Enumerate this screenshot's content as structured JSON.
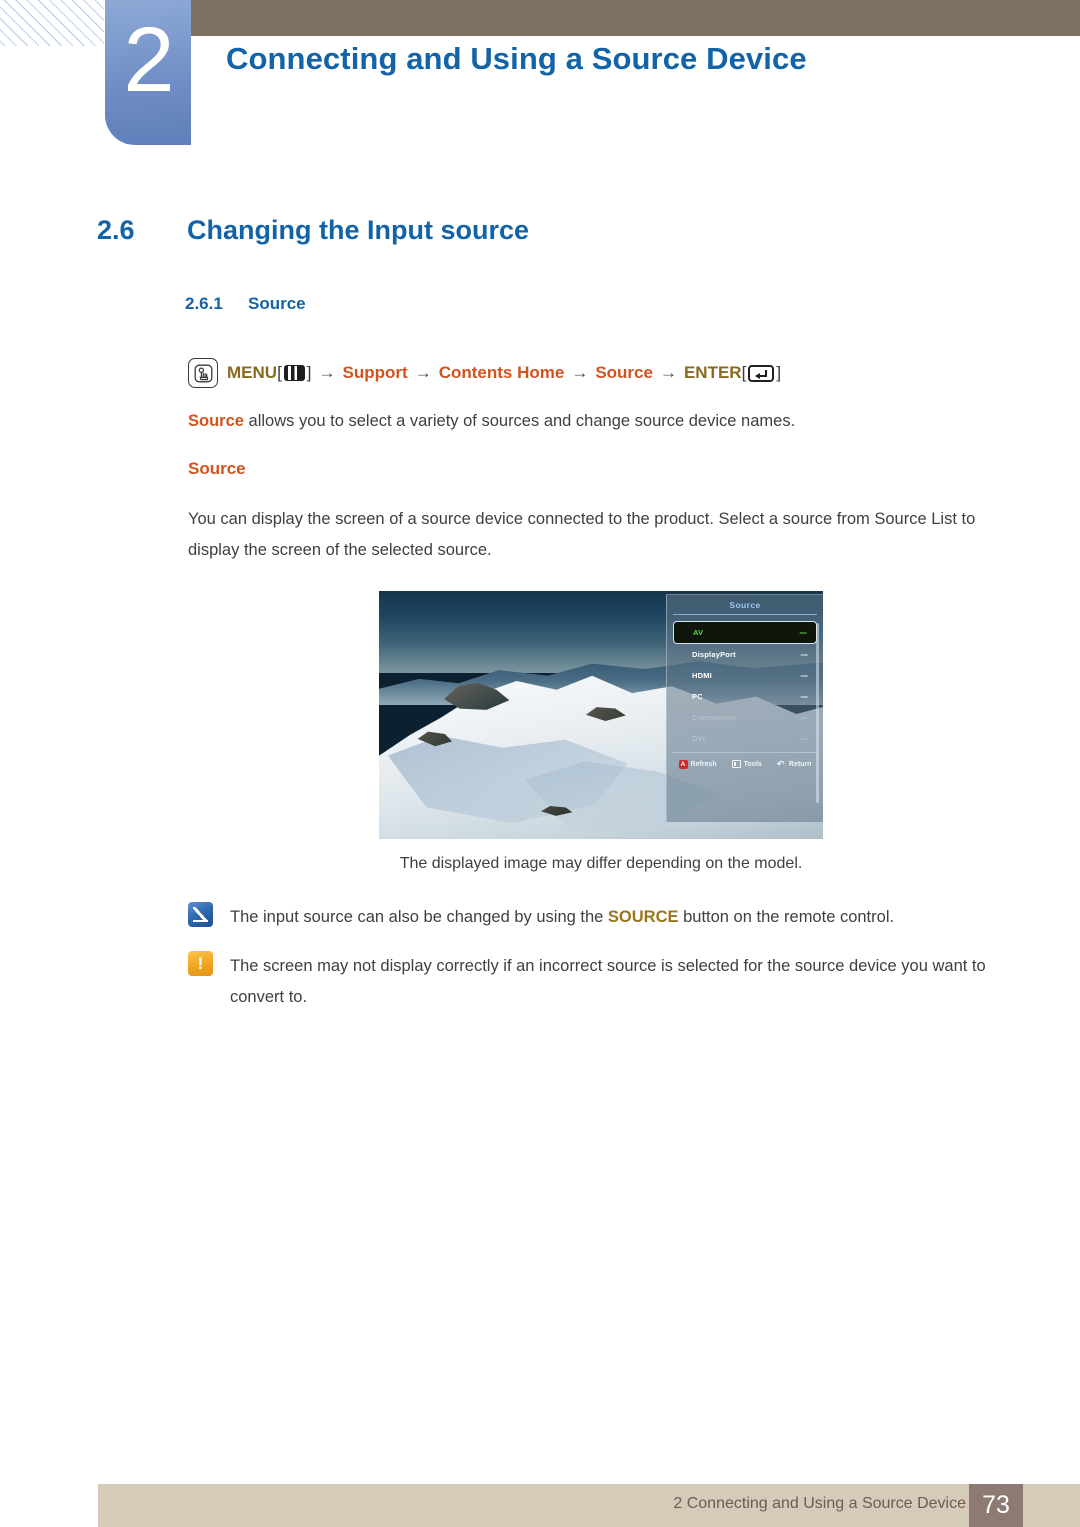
{
  "header": {
    "chapter_number": "2",
    "chapter_title": "Connecting and Using a Source Device",
    "brown_color": "#7e7062",
    "blue_color": "#1263a8"
  },
  "section": {
    "number": "2.6",
    "title": "Changing the Input source",
    "sub_number": "2.6.1",
    "sub_title": "Source"
  },
  "menu_path": {
    "hand_icon": "hand-press-icon",
    "menu_label": "MENU",
    "menu_icon": "menu-grid-icon",
    "arrow": "→",
    "bracket_open": "[",
    "bracket_close": "]",
    "step_support": "Support",
    "step_contents_home": "Contents Home",
    "step_source": "Source",
    "enter_label": "ENTER",
    "enter_icon": "enter-return-icon"
  },
  "body": {
    "lead_keyword": "Source",
    "lead_rest": " allows you to select a variety of sources and change source device names.",
    "sub_heading": "Source",
    "description": "You can display the screen of a source device connected to the product. Select a source from Source List to display the screen of the selected source."
  },
  "figure": {
    "caption": "The displayed image may differ depending on the model.",
    "osd": {
      "title": "Source",
      "items": [
        {
          "label": "AV",
          "value": "----",
          "state": "selected"
        },
        {
          "label": "DisplayPort",
          "value": "----",
          "state": "normal"
        },
        {
          "label": "HDMI",
          "value": "----",
          "state": "normal"
        },
        {
          "label": "PC",
          "value": "----",
          "state": "normal"
        },
        {
          "label": "Component",
          "value": "----",
          "state": "dimmed"
        },
        {
          "label": "DVI",
          "value": "----",
          "state": "dimmed"
        }
      ],
      "footer": [
        {
          "icon": "a-button-icon",
          "icon_label": "A",
          "label": "Refresh"
        },
        {
          "icon": "tools-icon",
          "icon_label": "",
          "label": "Tools"
        },
        {
          "icon": "return-icon",
          "icon_label": "↶",
          "label": "Return"
        }
      ]
    }
  },
  "notes": [
    {
      "icon": "note-pen-icon",
      "text_before": "The input source can also be changed by using the ",
      "highlight": "SOURCE",
      "text_after": " button on the remote control."
    },
    {
      "icon": "caution-exclamation-icon",
      "glyph": "!",
      "text": "The screen may not display correctly if an incorrect source is selected for the source device you want to convert to."
    }
  ],
  "footer": {
    "text": "2 Connecting and Using a Source Device",
    "page_number": "73"
  }
}
